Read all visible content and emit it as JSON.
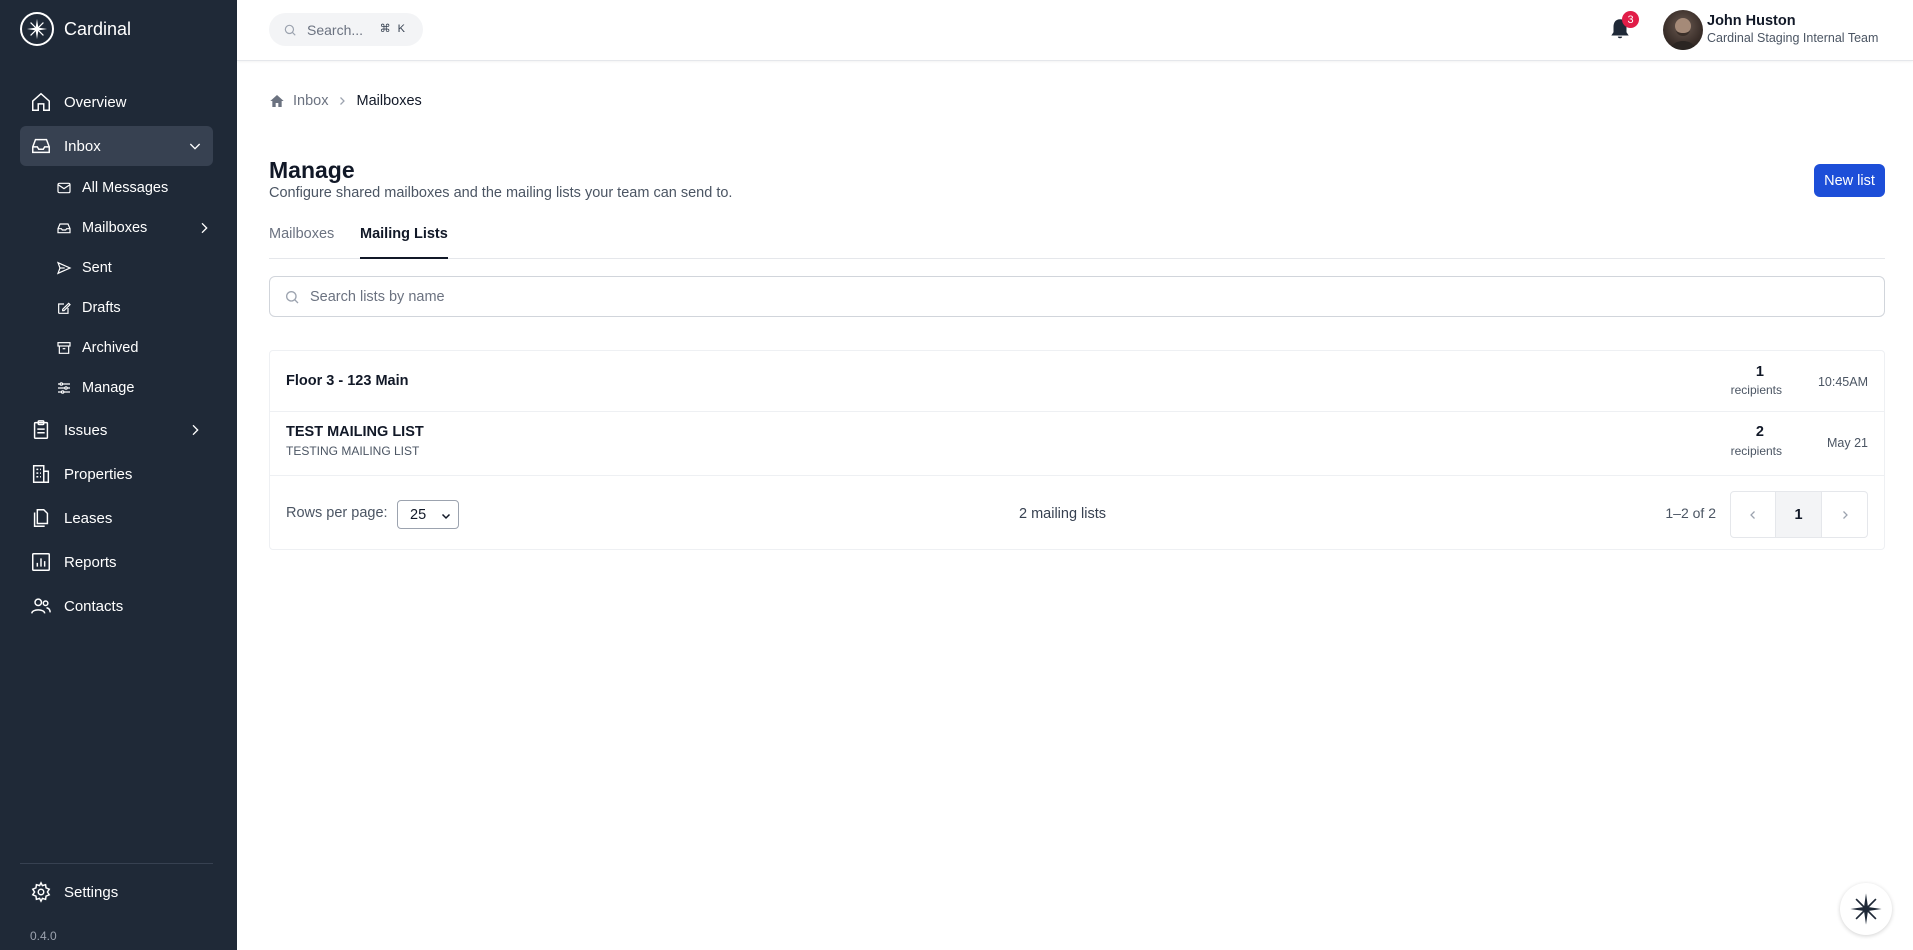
{
  "app": {
    "name": "Cardinal",
    "version": "0.4.0"
  },
  "sidebar": {
    "items": [
      {
        "label": "Overview"
      },
      {
        "label": "Inbox"
      },
      {
        "label": "Issues"
      },
      {
        "label": "Properties"
      },
      {
        "label": "Leases"
      },
      {
        "label": "Reports"
      },
      {
        "label": "Contacts"
      }
    ],
    "inbox_sub": [
      {
        "label": "All Messages"
      },
      {
        "label": "Mailboxes"
      },
      {
        "label": "Sent"
      },
      {
        "label": "Drafts"
      },
      {
        "label": "Archived"
      },
      {
        "label": "Manage"
      }
    ],
    "settings_label": "Settings"
  },
  "topbar": {
    "search_placeholder": "Search...",
    "search_shortcut": "⌘ K",
    "notification_count": "3",
    "user_name": "John Huston",
    "user_team": "Cardinal Staging Internal Team"
  },
  "breadcrumb": {
    "home": "Inbox",
    "current": "Mailboxes"
  },
  "page": {
    "title": "Manage",
    "subtitle": "Configure shared mailboxes and the mailing lists your team can send to.",
    "new_button": "New list"
  },
  "tabs": [
    {
      "label": "Mailboxes",
      "active": false
    },
    {
      "label": "Mailing Lists",
      "active": true
    }
  ],
  "list_search_placeholder": "Search lists by name",
  "lists": [
    {
      "name": "Floor 3 - 123 Main",
      "description": "",
      "count": "1",
      "count_label": "recipients",
      "time": "10:45AM"
    },
    {
      "name": "TEST MAILING LIST",
      "description": "TESTING MAILING LIST",
      "count": "2",
      "count_label": "recipients",
      "time": "May 21"
    }
  ],
  "pagination": {
    "rows_per_page_label": "Rows per page:",
    "rows_per_page": "25",
    "total_label": "2 mailing lists",
    "range": "1–2 of 2",
    "current_page": "1"
  },
  "colors": {
    "sidebar": "#1f2937",
    "primary": "#1d4ed8",
    "badge": "#e11d48"
  }
}
